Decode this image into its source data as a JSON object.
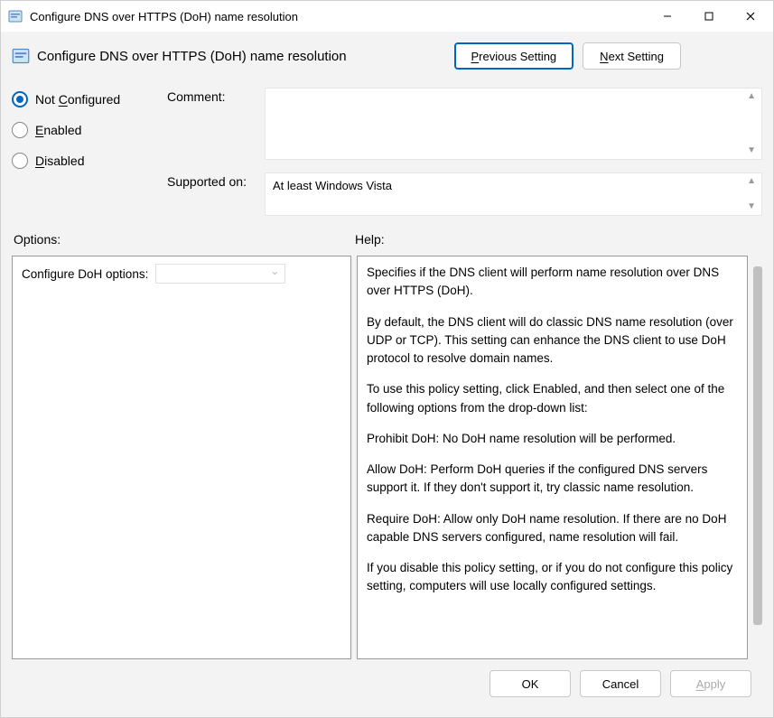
{
  "window": {
    "title": "Configure DNS over HTTPS (DoH) name resolution"
  },
  "header": {
    "title": "Configure DNS over HTTPS (DoH) name resolution",
    "prev_label_pre": "P",
    "prev_label_post": "revious Setting",
    "next_label_pre": "N",
    "next_label_post": "ext Setting"
  },
  "state": {
    "not_configured_pre": "Not ",
    "not_configured_u": "C",
    "not_configured_post": "onfigured",
    "enabled_u": "E",
    "enabled_post": "nabled",
    "disabled_u": "D",
    "disabled_post": "isabled",
    "comment_label": "Comment:",
    "supported_label": "Supported on:",
    "supported_value": "At least Windows Vista"
  },
  "sections": {
    "options_label": "Options:",
    "help_label": "Help:"
  },
  "options": {
    "doh_label": "Configure DoH options:",
    "doh_value": ""
  },
  "help": {
    "p1": "Specifies if the DNS client will perform name resolution over DNS over HTTPS (DoH).",
    "p2": "By default, the DNS client will do classic DNS name resolution (over UDP or TCP). This setting can enhance the DNS client to use DoH protocol to resolve domain names.",
    "p3": "To use this policy setting, click Enabled, and then select one of the following options from the drop-down list:",
    "p4": "Prohibit DoH: No DoH name resolution will be performed.",
    "p5": "Allow DoH: Perform DoH queries if the configured DNS servers support it. If they don't support it, try classic name resolution.",
    "p6": "Require DoH: Allow only DoH name resolution. If there are no DoH capable DNS servers configured, name resolution will fail.",
    "p7": "If you disable this policy setting, or if you do not configure this policy setting, computers will use locally configured settings."
  },
  "footer": {
    "ok": "OK",
    "cancel": "Cancel",
    "apply_u": "A",
    "apply_post": "pply"
  }
}
